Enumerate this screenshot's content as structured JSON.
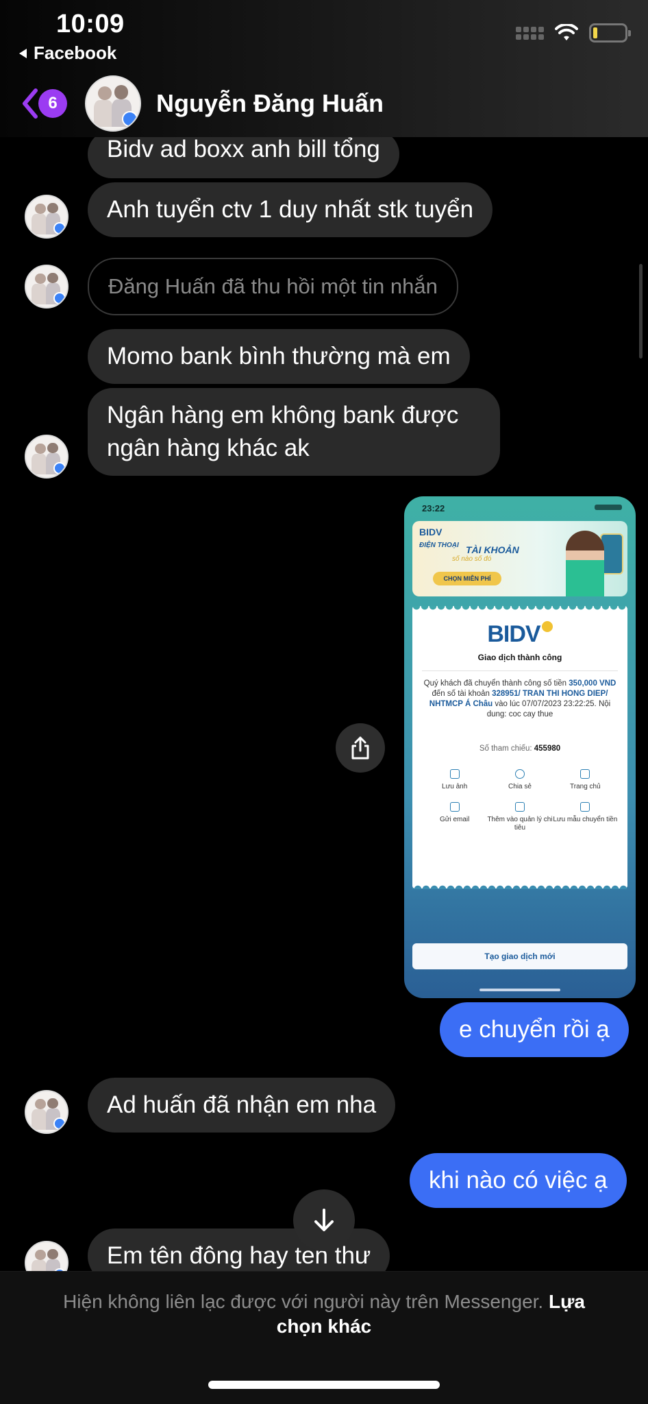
{
  "status_bar": {
    "time": "10:09",
    "back_app": "Facebook"
  },
  "header": {
    "unread_count": "6",
    "contact_name": "Nguyễn Đăng Huấn"
  },
  "messages": [
    {
      "text": "Bidv ad boxx anh bill tổng"
    },
    {
      "text": "Anh tuyển ctv 1 duy nhất stk tuyển"
    },
    {
      "text": "Đăng Huấn đã thu hồi một tin nhắn"
    },
    {
      "text": "Momo bank bình thường mà em"
    },
    {
      "text": "Ngân hàng em không bank được ngân hàng khác ak"
    },
    {
      "text": "e chuyển rồi ạ"
    },
    {
      "text": "Ad huấn đã nhận em nha"
    },
    {
      "text": "khi nào có việc ạ"
    },
    {
      "text": "Em tên đông hay ten thư"
    }
  ],
  "attachment": {
    "time": "23:22",
    "ad": {
      "logo": "BIDV",
      "line1": "ĐIỆN THOẠI",
      "line2": "TÀI KHOẢN",
      "line3": "số nào số đó",
      "button": "CHỌN MIỄN PHÍ"
    },
    "receipt": {
      "logo": "BIDV",
      "status": "Giao dịch thành công",
      "desc_pre": "Quý khách đã chuyển thành công số tiền ",
      "amount": "350,000 VND",
      "desc_mid": " đến số tài khoản ",
      "account": "328951/ TRAN THI HONG DIEP/ NHTMCP Á Châu",
      "desc_post": " vào lúc 07/07/2023 23:22:25. Nội dung: coc cay thue",
      "ref_label": "Số tham chiếu:",
      "ref_value": "455980",
      "actions": [
        "Lưu ảnh",
        "Chia sẻ",
        "Trang chủ",
        "Gửi email",
        "Thêm vào quản lý chi tiêu",
        "Lưu mẫu chuyển tiền"
      ],
      "new_transaction": "Tạo giao dịch mới"
    }
  },
  "footer": {
    "notice": "Hiện không liên lạc được với người này trên Messenger.",
    "link": "Lựa chọn khác"
  }
}
